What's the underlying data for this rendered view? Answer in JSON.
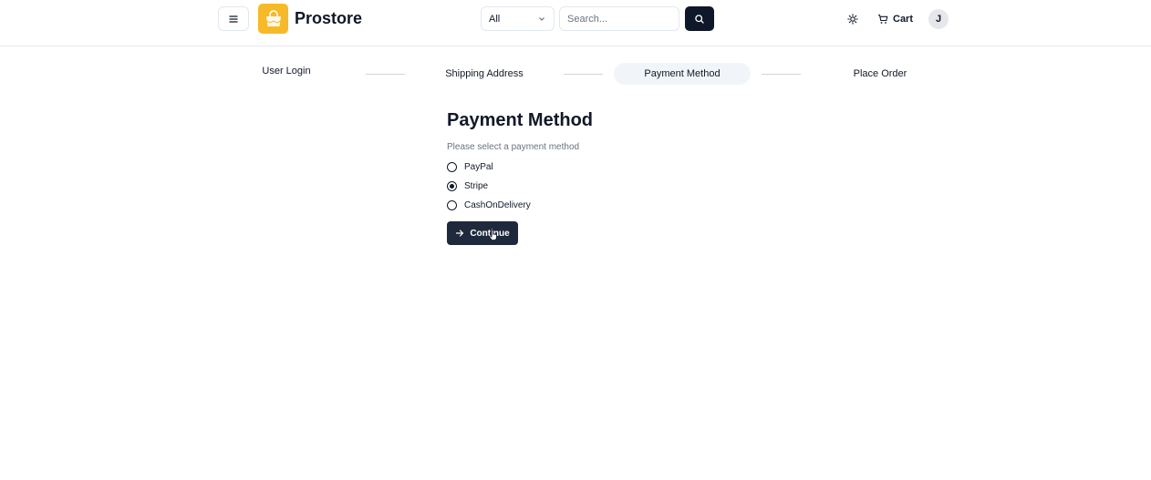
{
  "header": {
    "brand": "Prostore",
    "category_select": {
      "value": "All"
    },
    "search": {
      "placeholder": "Search..."
    },
    "cart_label": "Cart",
    "avatar_initial": "J",
    "accent_logo_color": "#f6b928"
  },
  "steps": [
    {
      "label": "User Login",
      "active": false
    },
    {
      "label": "Shipping Address",
      "active": false
    },
    {
      "label": "Payment Method",
      "active": true
    },
    {
      "label": "Place Order",
      "active": false
    }
  ],
  "main": {
    "title": "Payment Method",
    "subtitle": "Please select a payment method",
    "options": [
      {
        "label": "PayPal",
        "selected": false
      },
      {
        "label": "Stripe",
        "selected": true
      },
      {
        "label": "CashOnDelivery",
        "selected": false
      }
    ],
    "continue_label": "Continue"
  },
  "icons": [
    "menu-icon",
    "shopping-bag-icon",
    "chevron-down-icon",
    "search-icon",
    "sun-icon",
    "cart-icon",
    "arrow-right-icon",
    "hand-pointer-cursor"
  ]
}
